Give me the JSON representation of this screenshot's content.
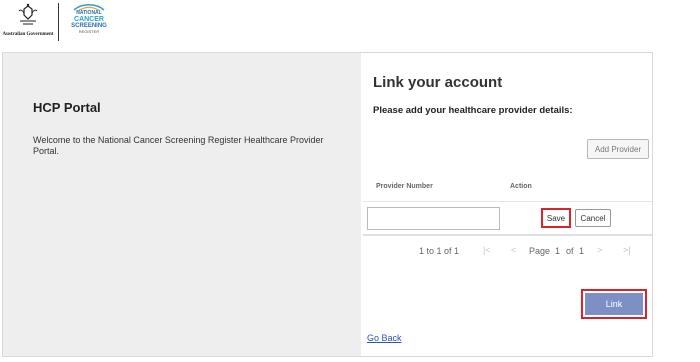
{
  "header": {
    "gov_logo_name": "Australian Government",
    "ncsr_logo": {
      "line1": "NATIONAL",
      "line2": "CANCER",
      "line3": "SCREENING",
      "line4": "REGISTER"
    }
  },
  "left_panel": {
    "title": "HCP Portal",
    "welcome": "Welcome to the National Cancer Screening Register Healthcare Provider Portal."
  },
  "right_panel": {
    "title": "Link your account",
    "subtitle": "Please add your healthcare provider details:",
    "add_provider_label": "Add Provider",
    "table": {
      "columns": [
        "Provider Number",
        "Action"
      ],
      "edit_row": {
        "provider_number_value": "",
        "save_label": "Save",
        "cancel_label": "Cancel"
      }
    },
    "pagination": {
      "summary": "1 to 1 of 1",
      "page_label": "Page",
      "page": "1",
      "of_label": "of",
      "total_pages": "1",
      "first_glyph": "|<",
      "prev_glyph": "<",
      "next_glyph": ">",
      "last_glyph": ">|"
    },
    "link_label": "Link",
    "go_back_label": "Go Back"
  },
  "colors": {
    "link_button": "#7d90c4",
    "highlight_border": "#d9232d",
    "go_back_link": "#2a52be",
    "left_panel_bg": "#eeeeee"
  }
}
